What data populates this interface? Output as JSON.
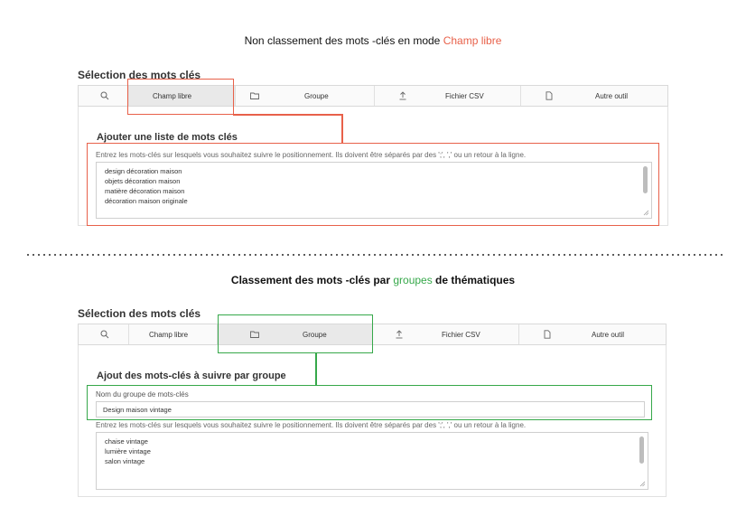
{
  "section1": {
    "heading_prefix": "Non classement des mots -clés en mode ",
    "heading_accent": "Champ libre",
    "selection_title": "Sélection des mots clés",
    "tabs": [
      {
        "label": "Champ libre",
        "icon": "search-icon"
      },
      {
        "label": "Groupe",
        "icon": "folder-icon"
      },
      {
        "label": "Fichier CSV",
        "icon": "upload-icon"
      },
      {
        "label": "Autre outil",
        "icon": "document-icon"
      }
    ],
    "active_tab": "Champ libre",
    "panel_title": "Ajouter une liste de mots clés",
    "help_text": "Entrez les mots-clés sur lesquels vous souhaitez suivre le positionnement. Ils doivent être séparés par des ';', ',' ou un retour à la ligne.",
    "keywords": [
      "design décoration maison",
      "objets décoration maison",
      "matière décoration maison",
      "décoration  maison originale"
    ],
    "highlight_color": "#e8614a"
  },
  "section2": {
    "heading_prefix": "Classement des mots -clés par ",
    "heading_accent": "groupes",
    "heading_suffix": " de thématiques",
    "selection_title": "Sélection des mots clés",
    "tabs": [
      {
        "label": "Champ libre",
        "icon": "search-icon"
      },
      {
        "label": "Groupe",
        "icon": "folder-icon"
      },
      {
        "label": "Fichier CSV",
        "icon": "upload-icon"
      },
      {
        "label": "Autre outil",
        "icon": "document-icon"
      }
    ],
    "active_tab": "Groupe",
    "panel_title": "Ajout des mots-clés à suivre par groupe",
    "group_name_label": "Nom du groupe de mots-clés",
    "group_name_value": "Design maison vintage",
    "help_text": "Entrez les mots-clés sur lesquels vous souhaitez suivre le positionnement. Ils doivent être séparés par des ';', ',' ou un retour à la ligne.",
    "keywords": [
      "chaise vintage",
      "lumière vintage",
      "salon vintage"
    ],
    "highlight_color": "#36a84a"
  }
}
